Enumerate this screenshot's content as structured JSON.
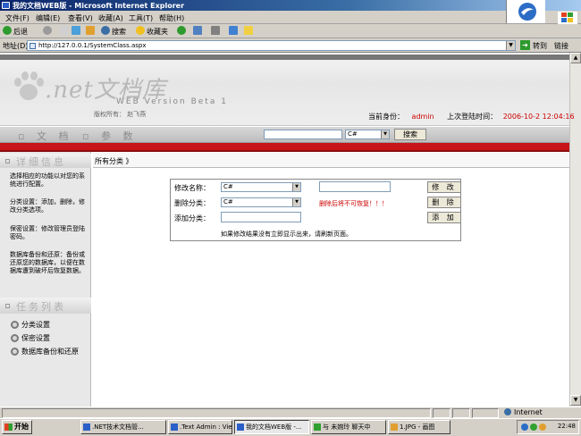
{
  "window": {
    "title": "我的文档WEB版 - Microsoft Internet Explorer"
  },
  "menu": [
    "文件(F)",
    "编辑(E)",
    "查看(V)",
    "收藏(A)",
    "工具(T)",
    "帮助(H)"
  ],
  "toolbar": {
    "back": "后退",
    "search": "搜索",
    "favorites": "收藏夹"
  },
  "address": {
    "label": "地址(D)",
    "url": "http://127.0.0.1/SystemClass.aspx",
    "go": "转到",
    "links": "链接"
  },
  "header": {
    "logo_title": ".net文档库",
    "logo_sub": "WEB  Version Beta 1",
    "logo_copy": "版权所有：  赵飞燕",
    "identity_label": "当前身份：",
    "identity_value": "admin",
    "lastlogin_label": "上次登陆时间：",
    "lastlogin_value": "2006-10-2 12:04:16"
  },
  "nav": {
    "item1": "▫ 文 档",
    "item2": "▫ 参 数",
    "search_select": "C#",
    "search_button": "搜索"
  },
  "sidebar": {
    "heading": "详细信息",
    "para1": "选择相应的功能以对您的系统进行配置。",
    "para2": "分类设置：添加，删除，修改分类选项。",
    "para3": "保密设置：修改管理员登陆密码。",
    "para4": "数据库备份和还原：备份或还原您的数据库，以便在数据库遭到破坏后恢复数据。",
    "task_heading": "任务列表",
    "tasks": [
      "分类设置",
      "保密设置",
      "数据库备份和还原"
    ]
  },
  "main": {
    "breadcrumb": "所有分类 》",
    "modify_label": "修改名称：",
    "modify_select": "C#",
    "modify_button": "修 改",
    "delete_label": "删除分类：",
    "delete_select": "C#",
    "delete_warning": "删除后将不可恢复！！！",
    "delete_button": "删 除",
    "add_label": "添加分类：",
    "add_button": "添 加",
    "note": "如果修改结果没有立即显示出来，请刷新页面。"
  },
  "status": {
    "zone": "Internet"
  },
  "taskbar": {
    "start": "开始",
    "items": [
      ".NET技术文档管...",
      ".Text Admin : View...",
      "我的文档WEB版 -...",
      "与 未婉玲 聊天中",
      "1.JPG - 画图"
    ],
    "clock": "22:48"
  }
}
